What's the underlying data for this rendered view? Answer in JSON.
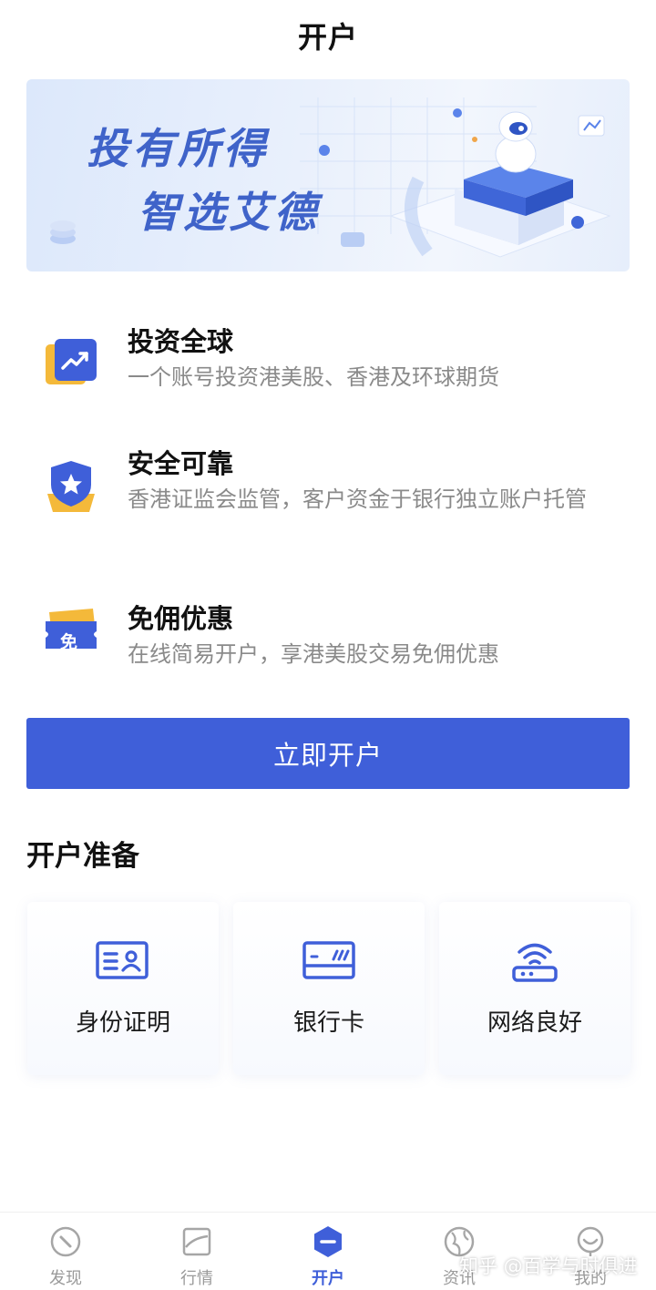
{
  "header": {
    "title": "开户"
  },
  "banner": {
    "line1": "投有所得",
    "line2": "智选艾德"
  },
  "features": [
    {
      "title": "投资全球",
      "desc": "一个账号投资港美股、香港及环球期货",
      "icon": "trend-chart-icon"
    },
    {
      "title": "安全可靠",
      "desc": "香港证监会监管，客户资金于银行独立账户托管",
      "icon": "shield-star-icon"
    },
    {
      "title": "免佣优惠",
      "desc": "在线简易开户，享港美股交易免佣优惠",
      "icon": "coupon-icon",
      "badge": "免"
    }
  ],
  "cta": {
    "label": "立即开户"
  },
  "prep": {
    "title": "开户准备",
    "items": [
      {
        "label": "身份证明",
        "icon": "id-card-icon"
      },
      {
        "label": "银行卡",
        "icon": "bank-card-icon"
      },
      {
        "label": "网络良好",
        "icon": "wifi-router-icon"
      }
    ]
  },
  "tabs": [
    {
      "label": "发现",
      "icon": "compass-icon"
    },
    {
      "label": "行情",
      "icon": "chart-icon"
    },
    {
      "label": "开户",
      "icon": "open-account-icon",
      "active": true
    },
    {
      "label": "资讯",
      "icon": "globe-icon"
    },
    {
      "label": "我的",
      "icon": "profile-icon"
    }
  ],
  "watermark": "知乎 @百学与时俱进",
  "colors": {
    "primary": "#3f5fd9",
    "banner_text": "#3f63c9",
    "icon_orange": "#f4b93a"
  }
}
